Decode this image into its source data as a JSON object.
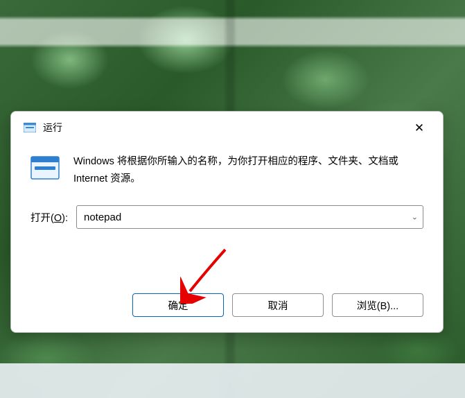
{
  "dialog": {
    "title": "运行",
    "description": "Windows 将根据你所输入的名称，为你打开相应的程序、文件夹、文档或 Internet 资源。",
    "open_label_prefix": "打开(",
    "open_label_key": "O",
    "open_label_suffix": "):",
    "input_value": "notepad",
    "buttons": {
      "ok": "确定",
      "cancel": "取消",
      "browse": "浏览(B)..."
    }
  }
}
